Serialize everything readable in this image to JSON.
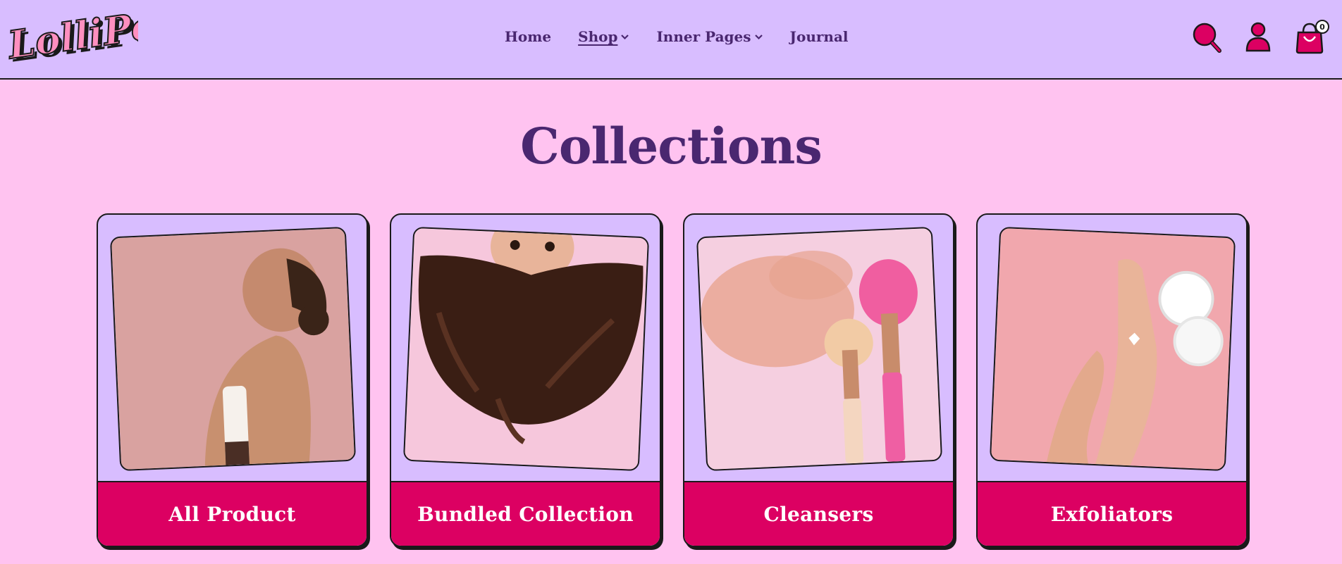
{
  "brand": {
    "logo_text": "LolliPop"
  },
  "nav": {
    "items": [
      {
        "label": "Home",
        "has_dropdown": false
      },
      {
        "label": "Shop",
        "has_dropdown": true
      },
      {
        "label": "Inner Pages",
        "has_dropdown": true
      },
      {
        "label": "Journal",
        "has_dropdown": false
      }
    ]
  },
  "header_icons": {
    "search": "search-icon",
    "account": "user-icon",
    "cart": "bag-icon",
    "cart_count": "0"
  },
  "page": {
    "title": "Collections"
  },
  "collections": [
    {
      "label": "All Product"
    },
    {
      "label": "Bundled Collection"
    },
    {
      "label": "Cleansers"
    },
    {
      "label": "Exfoliators"
    }
  ],
  "colors": {
    "header_bg": "#d8bdff",
    "page_bg": "#ffc3f0",
    "accent": "#dc0062",
    "text": "#4a2770"
  }
}
